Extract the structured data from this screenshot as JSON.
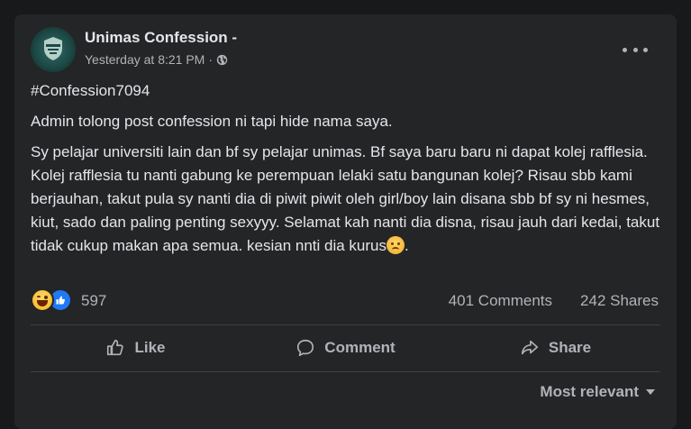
{
  "post": {
    "page_name": "Unimas Confession -",
    "timestamp": "Yesterday at 8:21 PM",
    "separator": "·",
    "privacy_icon": "globe-icon",
    "more_icon": "more-options-icon",
    "hashtag": "#Confession7094",
    "line1": "Admin tolong post confession ni tapi hide nama saya.",
    "body": "Sy pelajar universiti lain dan bf sy pelajar unimas. Bf saya baru baru ni dapat kolej rafflesia. Kolej rafflesia tu nanti gabung ke perempuan lelaki satu bangunan kolej? Risau sbb kami berjauhan, takut pula sy nanti dia di piwit piwit oleh girl/boy lain disana sbb bf sy ni hesmes, kiut, sado dan paling penting sexyyy. Selamat kah nanti dia disna, risau jauh dari kedai, takut tidak cukup makan apa semua. kesian nnti dia kurus",
    "body_emoji": "sad-face-emoji"
  },
  "stats": {
    "reaction_count": "597",
    "comments": "401 Comments",
    "shares": "242 Shares",
    "reaction_icons": [
      "haha-reaction-icon",
      "like-reaction-icon"
    ]
  },
  "actions": {
    "like": "Like",
    "comment": "Comment",
    "share": "Share"
  },
  "sort": {
    "label": "Most relevant"
  },
  "colors": {
    "background": "#18191a",
    "card": "#242526",
    "text_primary": "#e4e6eb",
    "text_secondary": "#b0b3b8",
    "like_blue": "#2078f4"
  }
}
